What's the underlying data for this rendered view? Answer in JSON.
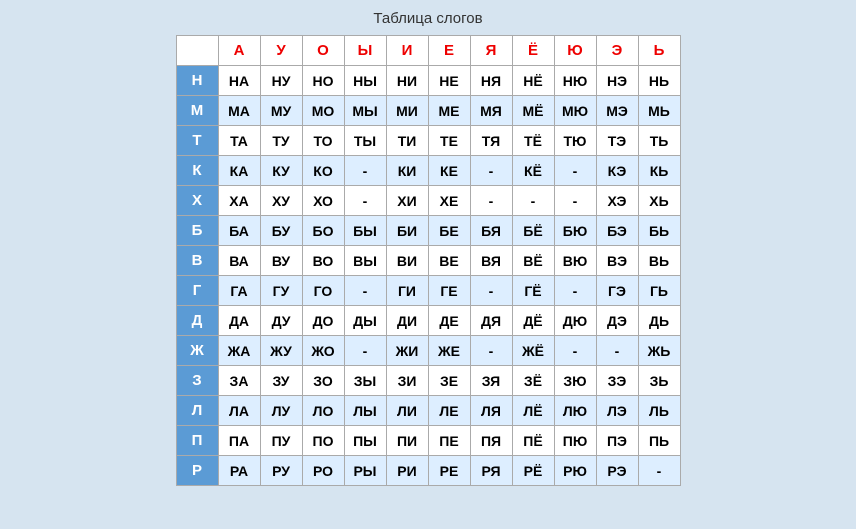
{
  "title": "Таблица слогов",
  "headers": [
    "",
    "А",
    "У",
    "О",
    "Ы",
    "И",
    "Е",
    "Я",
    "Ё",
    "Ю",
    "Э",
    "Ь"
  ],
  "rows": [
    {
      "label": "Н",
      "cells": [
        "НА",
        "НУ",
        "НО",
        "НЫ",
        "НИ",
        "НЕ",
        "НЯ",
        "НЁ",
        "НЮ",
        "НЭ",
        "НЬ"
      ]
    },
    {
      "label": "М",
      "cells": [
        "МА",
        "МУ",
        "МО",
        "МЫ",
        "МИ",
        "МЕ",
        "МЯ",
        "МЁ",
        "МЮ",
        "МЭ",
        "МЬ"
      ]
    },
    {
      "label": "Т",
      "cells": [
        "ТА",
        "ТУ",
        "ТО",
        "ТЫ",
        "ТИ",
        "ТЕ",
        "ТЯ",
        "ТЁ",
        "ТЮ",
        "ТЭ",
        "ТЬ"
      ]
    },
    {
      "label": "К",
      "cells": [
        "КА",
        "КУ",
        "КО",
        "-",
        "КИ",
        "КЕ",
        "-",
        "КЁ",
        "-",
        "КЭ",
        "КЬ"
      ]
    },
    {
      "label": "Х",
      "cells": [
        "ХА",
        "ХУ",
        "ХО",
        "-",
        "ХИ",
        "ХЕ",
        "-",
        "-",
        "-",
        "ХЭ",
        "ХЬ"
      ]
    },
    {
      "label": "Б",
      "cells": [
        "БА",
        "БУ",
        "БО",
        "БЫ",
        "БИ",
        "БЕ",
        "БЯ",
        "БЁ",
        "БЮ",
        "БЭ",
        "БЬ"
      ]
    },
    {
      "label": "В",
      "cells": [
        "ВА",
        "ВУ",
        "ВО",
        "ВЫ",
        "ВИ",
        "ВЕ",
        "ВЯ",
        "ВЁ",
        "ВЮ",
        "ВЭ",
        "ВЬ"
      ]
    },
    {
      "label": "Г",
      "cells": [
        "ГА",
        "ГУ",
        "ГО",
        "-",
        "ГИ",
        "ГЕ",
        "-",
        "ГЁ",
        "-",
        "ГЭ",
        "ГЬ"
      ]
    },
    {
      "label": "Д",
      "cells": [
        "ДА",
        "ДУ",
        "ДО",
        "ДЫ",
        "ДИ",
        "ДЕ",
        "ДЯ",
        "ДЁ",
        "ДЮ",
        "ДЭ",
        "ДЬ"
      ]
    },
    {
      "label": "Ж",
      "cells": [
        "ЖА",
        "ЖУ",
        "ЖО",
        "-",
        "ЖИ",
        "ЖЕ",
        "-",
        "ЖЁ",
        "-",
        "-",
        "ЖЬ"
      ]
    },
    {
      "label": "З",
      "cells": [
        "ЗА",
        "ЗУ",
        "ЗО",
        "ЗЫ",
        "ЗИ",
        "ЗЕ",
        "ЗЯ",
        "ЗЁ",
        "ЗЮ",
        "ЗЭ",
        "ЗЬ"
      ]
    },
    {
      "label": "Л",
      "cells": [
        "ЛА",
        "ЛУ",
        "ЛО",
        "ЛЫ",
        "ЛИ",
        "ЛЕ",
        "ЛЯ",
        "ЛЁ",
        "ЛЮ",
        "ЛЭ",
        "ЛЬ"
      ]
    },
    {
      "label": "П",
      "cells": [
        "ПА",
        "ПУ",
        "ПО",
        "ПЫ",
        "ПИ",
        "ПЕ",
        "ПЯ",
        "ПЁ",
        "ПЮ",
        "ПЭ",
        "ПЬ"
      ]
    },
    {
      "label": "Р",
      "cells": [
        "РА",
        "РУ",
        "РО",
        "РЫ",
        "РИ",
        "РЕ",
        "РЯ",
        "РЁ",
        "РЮ",
        "РЭ",
        "-"
      ]
    }
  ]
}
